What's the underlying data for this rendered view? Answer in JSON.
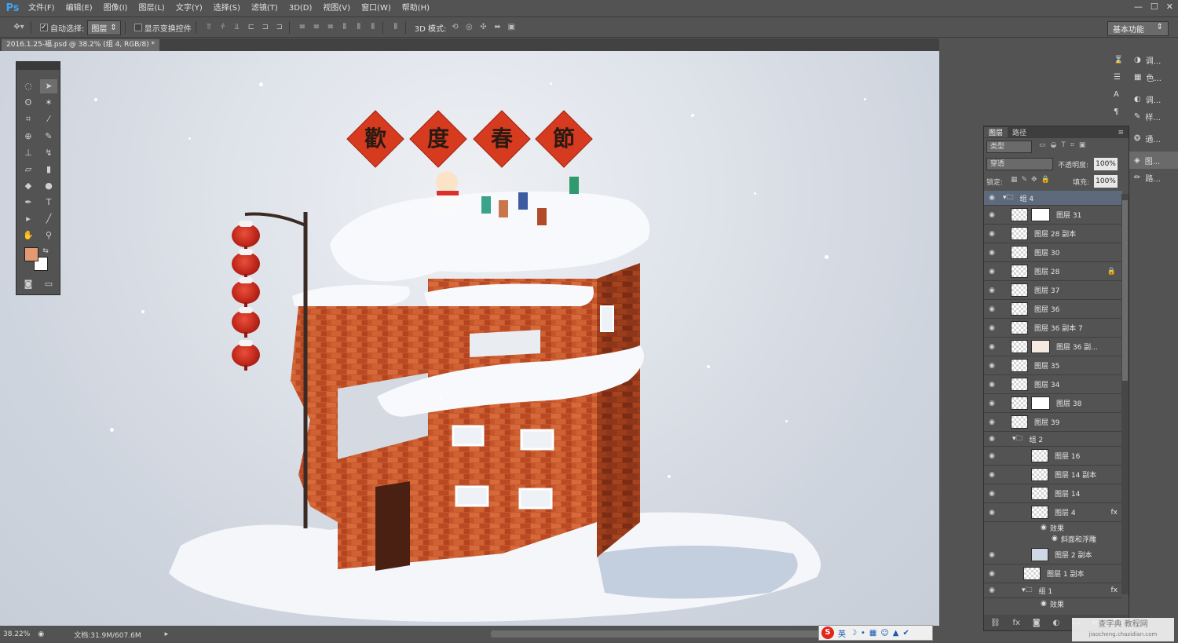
{
  "app": {
    "logo": "Ps"
  },
  "menu": [
    "文件(F)",
    "编辑(E)",
    "图像(I)",
    "图层(L)",
    "文字(Y)",
    "选择(S)",
    "滤镜(T)",
    "3D(D)",
    "视图(V)",
    "窗口(W)",
    "帮助(H)"
  ],
  "window_controls": [
    "—",
    "☐",
    "✕"
  ],
  "options": {
    "move_icon": "move-icon",
    "auto_select_label": "自动选择:",
    "auto_select_value": "图层",
    "show_transform_label": "显示变换控件",
    "mode_3d_label": "3D 模式:",
    "workspace": "基本功能"
  },
  "document": {
    "tab": "2016.1.25-福.psd @ 38.2% (组 4, RGB/8) *"
  },
  "status": {
    "zoom": "38.22%",
    "doc_size": "文档:31.9M/607.6M"
  },
  "artwork": {
    "banner_chars": [
      "歡",
      "度",
      "春",
      "節"
    ]
  },
  "dock": {
    "group1": [
      "调...",
      "色..."
    ],
    "group2": [
      "调...",
      "样..."
    ],
    "group3": [
      "通..."
    ],
    "group4": [
      "图...",
      "路..."
    ]
  },
  "layers_panel": {
    "tabs": [
      "图层",
      "路径"
    ],
    "filter_kind": "类型",
    "blend_mode": "穿透",
    "opacity_label": "不透明度:",
    "opacity_value": "100%",
    "lock_label": "锁定:",
    "fill_label": "填充:",
    "fill_value": "100%",
    "rows": [
      {
        "name": "组 4",
        "type": "group"
      },
      {
        "name": "图层 31",
        "type": "mask"
      },
      {
        "name": "图层 28 副本",
        "type": "layer"
      },
      {
        "name": "图层 30",
        "type": "layer"
      },
      {
        "name": "图层 28",
        "type": "layer"
      },
      {
        "name": "图层 37",
        "type": "layer"
      },
      {
        "name": "图层 36",
        "type": "layer"
      },
      {
        "name": "图层 36 副本 7",
        "type": "layer"
      },
      {
        "name": "图层 36 副...",
        "type": "mask"
      },
      {
        "name": "图层 35",
        "type": "layer"
      },
      {
        "name": "图层 34",
        "type": "layer"
      },
      {
        "name": "图层 38",
        "type": "mask"
      },
      {
        "name": "图层 39",
        "type": "layer"
      },
      {
        "name": "组 2",
        "type": "group"
      },
      {
        "name": "图层 16",
        "type": "layer"
      },
      {
        "name": "图层 14 副本",
        "type": "layer"
      },
      {
        "name": "图层 14",
        "type": "layer"
      },
      {
        "name": "图层 4",
        "type": "layer"
      },
      {
        "name": "效果",
        "type": "effect"
      },
      {
        "name": "斜面和浮雕",
        "type": "effect"
      },
      {
        "name": "图层 2 副本",
        "type": "layer"
      },
      {
        "name": "图层 1 副本",
        "type": "layer"
      },
      {
        "name": "组 1",
        "type": "group"
      },
      {
        "name": "效果",
        "type": "effect"
      }
    ]
  },
  "taskbar": {
    "ime": "英"
  },
  "watermark": {
    "line1": "查字典 教程网",
    "line2": "jiaocheng.chazidian.com"
  }
}
